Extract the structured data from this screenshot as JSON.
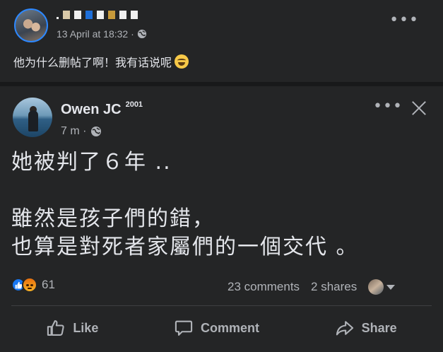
{
  "outer_post": {
    "meta_date": "13 April at 18:32 ·",
    "text": "他为什么删帖了啊！我有话说呢",
    "more_label": "•••",
    "name_block_colors": [
      "#f0f0f0",
      "#d9c9a8",
      "#f0f0f0",
      "#1e6fd9",
      "#f0f0f0",
      "#c89a3a",
      "#1b3a5c",
      "#f0f0f0",
      "#f0f0f0"
    ]
  },
  "shared_post": {
    "author": "Owen JC",
    "author_badge": "2001",
    "time": "7 m ·",
    "more_label": "•••",
    "body_lines": [
      "她被判了６年 ..",
      "",
      "雖然是孩子們的錯，",
      "也算是對死者家屬們的一個交代 。"
    ],
    "reaction_count": "61",
    "comments": "23 comments",
    "shares": "2 shares",
    "actions": {
      "like": "Like",
      "comment": "Comment",
      "share": "Share"
    }
  },
  "icons": {
    "privacy": "globe-icon",
    "like": "thumbs-up-icon",
    "comment": "speech-bubble-icon",
    "share": "share-arrow-icon",
    "close": "close-icon"
  },
  "colors": {
    "page": "#18191a",
    "card": "#242526",
    "text_primary": "#e4e6eb",
    "text_secondary": "#b0b3b8",
    "accent": "#1877f2"
  }
}
